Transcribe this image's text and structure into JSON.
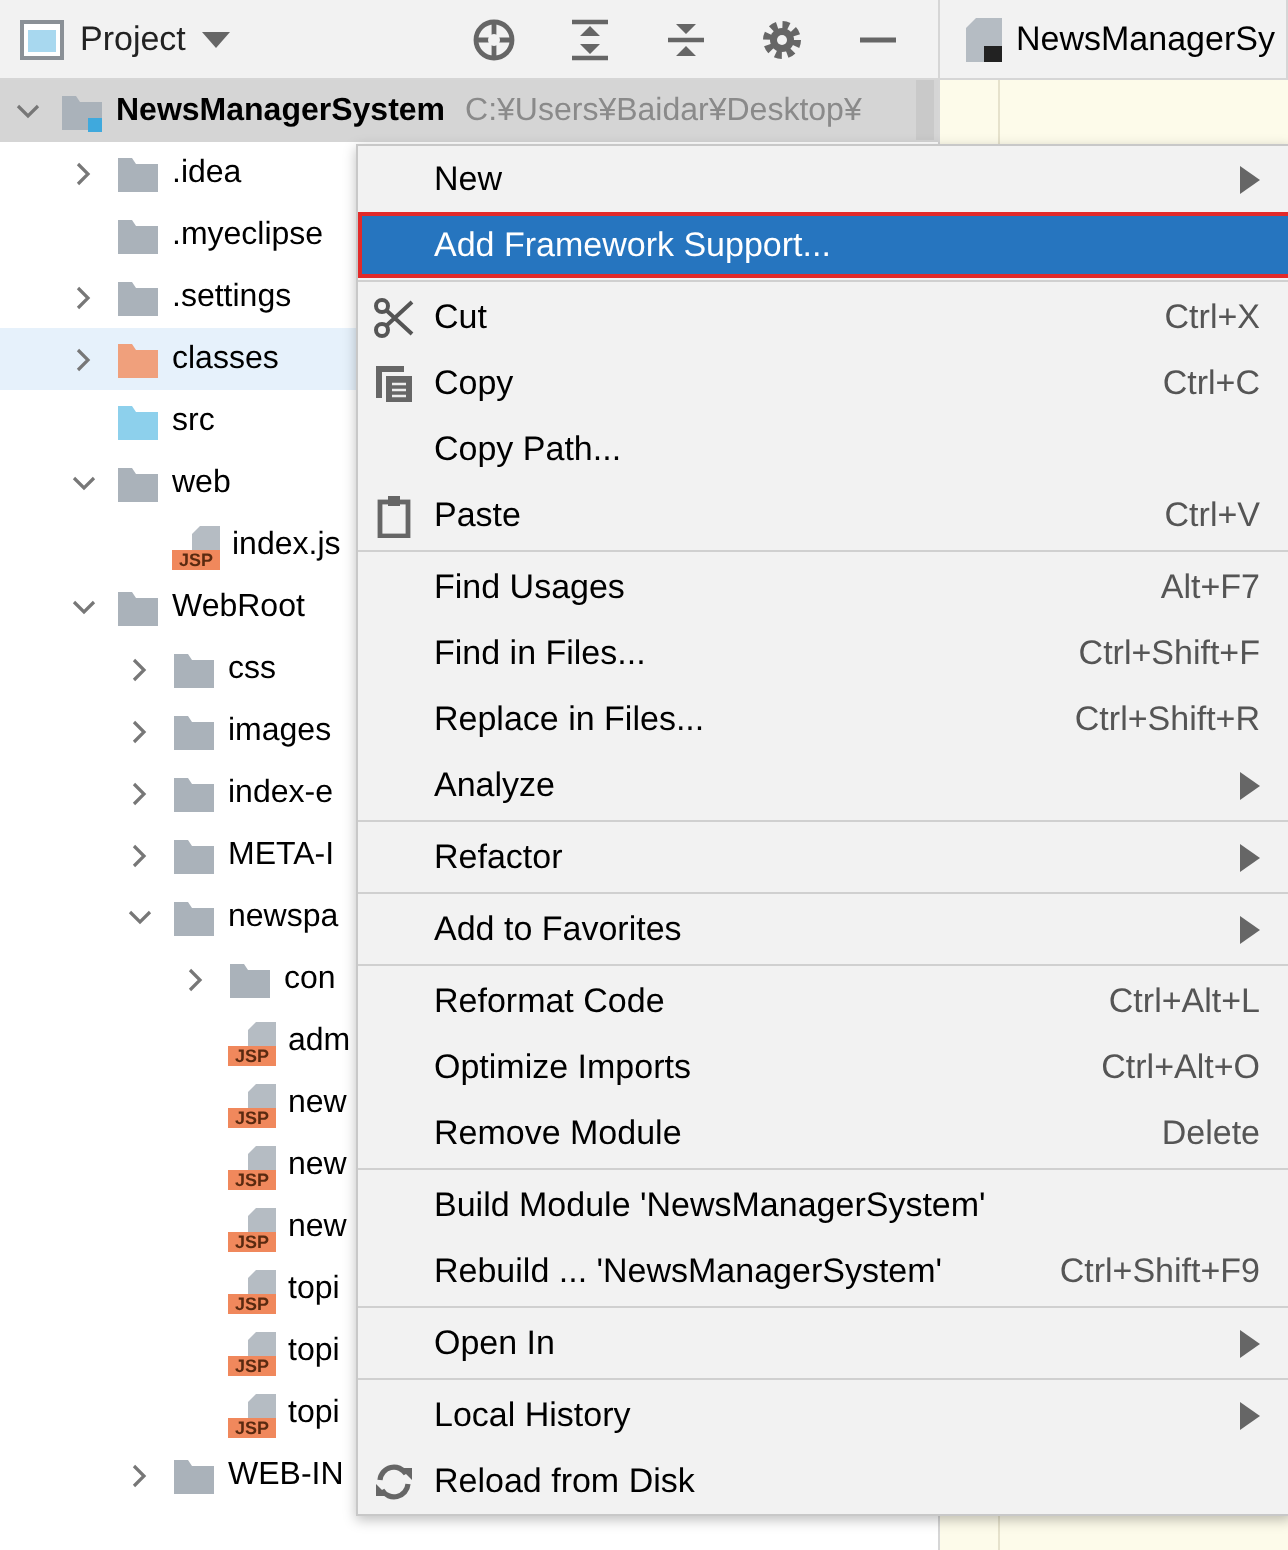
{
  "toolbar": {
    "title": "Project"
  },
  "editor_tab": {
    "label": "NewsManagerSy"
  },
  "tree": [
    {
      "label": "NewsManagerSystem",
      "path": "C:¥Users¥Baidar¥Desktop¥",
      "kind": "module",
      "expanded": true,
      "selected": true,
      "hovered": false,
      "children": [
        {
          "label": ".idea",
          "kind": "folder",
          "color": "#aab2ba",
          "expanded": false,
          "selected": false,
          "hovered": false
        },
        {
          "label": ".myeclipse",
          "kind": "folder",
          "color": "#aab2ba",
          "selected": false,
          "hovered": false
        },
        {
          "label": ".settings",
          "kind": "folder",
          "color": "#aab2ba",
          "expanded": false,
          "selected": false,
          "hovered": false
        },
        {
          "label": "classes",
          "kind": "folder",
          "color": "#f0a07c",
          "expanded": false,
          "selected": false,
          "hovered": true
        },
        {
          "label": "src",
          "kind": "folder",
          "color": "#8dd0ec",
          "selected": false,
          "hovered": false
        },
        {
          "label": "web",
          "kind": "folder",
          "color": "#aab2ba",
          "expanded": true,
          "selected": false,
          "hovered": false,
          "children": [
            {
              "label": "index.js",
              "kind": "file",
              "badge": "JSP",
              "selected": false,
              "hovered": false
            }
          ]
        },
        {
          "label": "WebRoot",
          "kind": "folder",
          "color": "#aab2ba",
          "expanded": true,
          "selected": false,
          "hovered": false,
          "children": [
            {
              "label": "css",
              "kind": "folder",
              "color": "#aab2ba",
              "expanded": false,
              "selected": false,
              "hovered": false
            },
            {
              "label": "images",
              "kind": "folder",
              "color": "#aab2ba",
              "expanded": false,
              "selected": false,
              "hovered": false
            },
            {
              "label": "index-e",
              "kind": "folder",
              "color": "#aab2ba",
              "expanded": false,
              "selected": false,
              "hovered": false
            },
            {
              "label": "META-I",
              "kind": "folder",
              "color": "#aab2ba",
              "expanded": false,
              "selected": false,
              "hovered": false
            },
            {
              "label": "newspa",
              "kind": "folder",
              "color": "#aab2ba",
              "expanded": true,
              "selected": false,
              "hovered": false,
              "children": [
                {
                  "label": "con",
                  "kind": "folder",
                  "color": "#aab2ba",
                  "expanded": false,
                  "selected": false,
                  "hovered": false
                },
                {
                  "label": "adm",
                  "kind": "file",
                  "badge": "JSP",
                  "selected": false,
                  "hovered": false
                },
                {
                  "label": "new",
                  "kind": "file",
                  "badge": "JSP",
                  "selected": false,
                  "hovered": false
                },
                {
                  "label": "new",
                  "kind": "file",
                  "badge": "JSP",
                  "selected": false,
                  "hovered": false
                },
                {
                  "label": "new",
                  "kind": "file",
                  "badge": "JSP",
                  "selected": false,
                  "hovered": false
                },
                {
                  "label": "topi",
                  "kind": "file",
                  "badge": "JSP",
                  "selected": false,
                  "hovered": false
                },
                {
                  "label": "topi",
                  "kind": "file",
                  "badge": "JSP",
                  "selected": false,
                  "hovered": false
                },
                {
                  "label": "topi",
                  "kind": "file",
                  "badge": "JSP",
                  "selected": false,
                  "hovered": false
                }
              ]
            },
            {
              "label": "WEB-IN",
              "kind": "folder",
              "color": "#aab2ba",
              "expanded": false,
              "selected": false,
              "hovered": false
            }
          ]
        }
      ]
    }
  ],
  "menu": {
    "items": [
      {
        "kind": "item",
        "label": "New",
        "submenu": true,
        "selected": false
      },
      {
        "kind": "item",
        "label": "Add Framework Support...",
        "selected": true
      },
      {
        "kind": "separator"
      },
      {
        "kind": "cut",
        "label": "Cut",
        "shortcut": "Ctrl+X",
        "selected": false
      },
      {
        "kind": "copy",
        "label": "Copy",
        "shortcut": "Ctrl+C",
        "selected": false
      },
      {
        "kind": "item",
        "label": "Copy Path...",
        "selected": false
      },
      {
        "kind": "paste",
        "label": "Paste",
        "shortcut": "Ctrl+V",
        "selected": false
      },
      {
        "kind": "separator"
      },
      {
        "kind": "item",
        "label": "Find Usages",
        "shortcut": "Alt+F7",
        "selected": false
      },
      {
        "kind": "item",
        "label": "Find in Files...",
        "shortcut": "Ctrl+Shift+F",
        "selected": false
      },
      {
        "kind": "item",
        "label": "Replace in Files...",
        "shortcut": "Ctrl+Shift+R",
        "selected": false
      },
      {
        "kind": "item",
        "label": "Analyze",
        "submenu": true,
        "selected": false
      },
      {
        "kind": "separator"
      },
      {
        "kind": "item",
        "label": "Refactor",
        "submenu": true,
        "selected": false
      },
      {
        "kind": "separator"
      },
      {
        "kind": "item",
        "label": "Add to Favorites",
        "submenu": true,
        "selected": false
      },
      {
        "kind": "separator"
      },
      {
        "kind": "item",
        "label": "Reformat Code",
        "shortcut": "Ctrl+Alt+L",
        "selected": false
      },
      {
        "kind": "item",
        "label": "Optimize Imports",
        "shortcut": "Ctrl+Alt+O",
        "selected": false
      },
      {
        "kind": "item",
        "label": "Remove Module",
        "shortcut": "Delete",
        "selected": false
      },
      {
        "kind": "separator"
      },
      {
        "kind": "item",
        "label": "Build Module 'NewsManagerSystem'",
        "selected": false
      },
      {
        "kind": "item",
        "label": "Rebuild ... 'NewsManagerSystem'",
        "shortcut": "Ctrl+Shift+F9",
        "selected": false
      },
      {
        "kind": "separator"
      },
      {
        "kind": "item",
        "label": "Open In",
        "submenu": true,
        "selected": false
      },
      {
        "kind": "separator"
      },
      {
        "kind": "item",
        "label": "Local History",
        "submenu": true,
        "selected": false
      },
      {
        "kind": "reload",
        "label": "Reload from Disk",
        "selected": false
      }
    ]
  }
}
